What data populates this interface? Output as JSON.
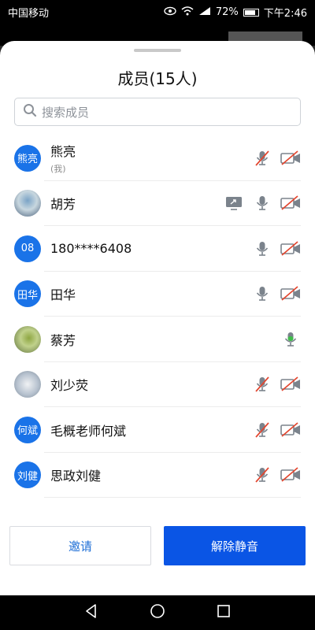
{
  "status": {
    "carrier": "中国移动",
    "battery": "72%",
    "time": "下午2:46"
  },
  "sheet": {
    "title": "成员(15人)",
    "search_placeholder": "搜索成员"
  },
  "members": [
    {
      "avatar_text": "熊亮",
      "name": "熊亮",
      "sub": "(我)",
      "screen": false,
      "mic": "muted",
      "camera": "off"
    },
    {
      "avatar_text": "",
      "name": "胡芳",
      "sub": "",
      "screen": true,
      "mic": "on",
      "camera": "off"
    },
    {
      "avatar_text": "08",
      "name": "180****6408",
      "sub": "",
      "screen": false,
      "mic": "on",
      "camera": "off"
    },
    {
      "avatar_text": "田华",
      "name": "田华",
      "sub": "",
      "screen": false,
      "mic": "on",
      "camera": "off"
    },
    {
      "avatar_text": "",
      "name": "蔡芳",
      "sub": "",
      "screen": false,
      "mic": "active",
      "camera": "none"
    },
    {
      "avatar_text": "",
      "name": "刘少荧",
      "sub": "",
      "screen": false,
      "mic": "muted",
      "camera": "off"
    },
    {
      "avatar_text": "何斌",
      "name": "毛概老师何斌",
      "sub": "",
      "screen": false,
      "mic": "muted",
      "camera": "off"
    },
    {
      "avatar_text": "刘健",
      "name": "思政刘健",
      "sub": "",
      "screen": false,
      "mic": "muted",
      "camera": "off"
    }
  ],
  "actions": {
    "invite": "邀请",
    "unmute_all": "解除静音"
  },
  "colors": {
    "primary": "#0a55e5",
    "avatar_blue": "#1a73e8",
    "muted_red": "#e3462f",
    "active_green": "#3fbd4a",
    "icon_gray": "#7b838c"
  }
}
